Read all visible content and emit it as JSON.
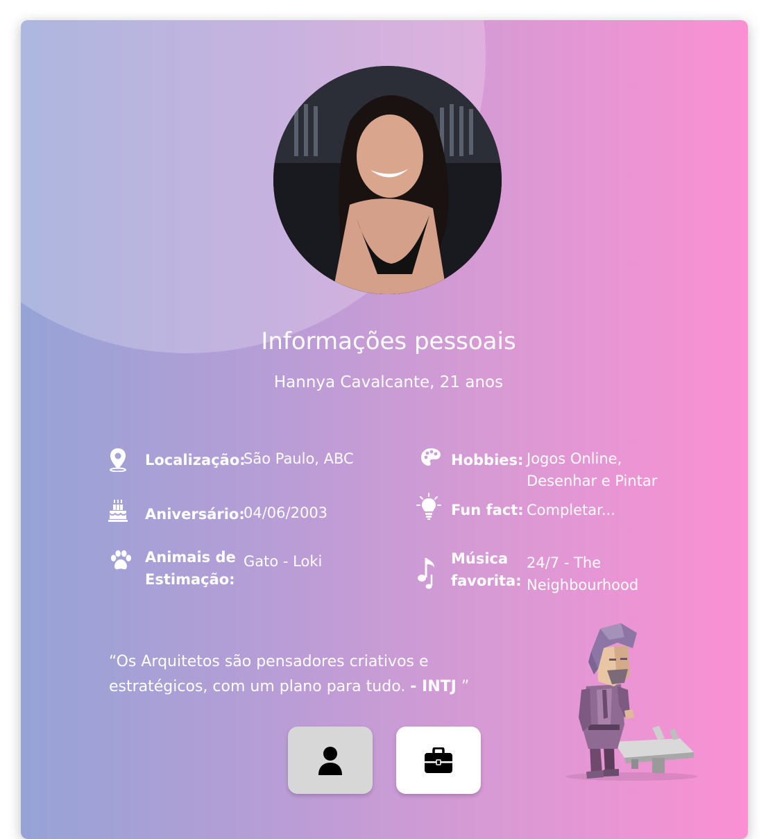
{
  "profile": {
    "heading": "Informações pessoais",
    "name_age": "Hannya Cavalcante, 21 anos"
  },
  "info": {
    "location": {
      "label": "Localização:",
      "value": "São Paulo, ABC",
      "icon": "map-pin-icon"
    },
    "birthday": {
      "label": "Aniversário:",
      "value": "04/06/2003",
      "icon": "birthday-cake-icon"
    },
    "pets": {
      "label_line1": "Animais de",
      "label_line2": "Estimação:",
      "value": "Gato - Loki",
      "icon": "paw-icon"
    },
    "hobbies": {
      "label": "Hobbies:",
      "value_line1": "Jogos Online,",
      "value_line2": "Desenhar e Pintar",
      "icon": "palette-icon"
    },
    "fun_fact": {
      "label": "Fun fact:",
      "value": "Completar...",
      "icon": "lightbulb-icon"
    },
    "music": {
      "label_line1": "Música",
      "label_line2": "favorita:",
      "value_line1": "24/7 - The",
      "value_line2": "Neighbourhood",
      "icon": "music-note-icon"
    }
  },
  "quote": {
    "text": "“Os Arquitetos são pensadores criativos e estratégicos, com um plano para tudo.",
    "emphasis": "- INTJ",
    "close": " ”"
  },
  "buttons": {
    "profile_icon": "user-icon",
    "work_icon": "briefcase-icon"
  },
  "colors": {
    "gradient_start": "#96a3d6",
    "gradient_end": "#fb90d3",
    "text": "#ffffff"
  }
}
